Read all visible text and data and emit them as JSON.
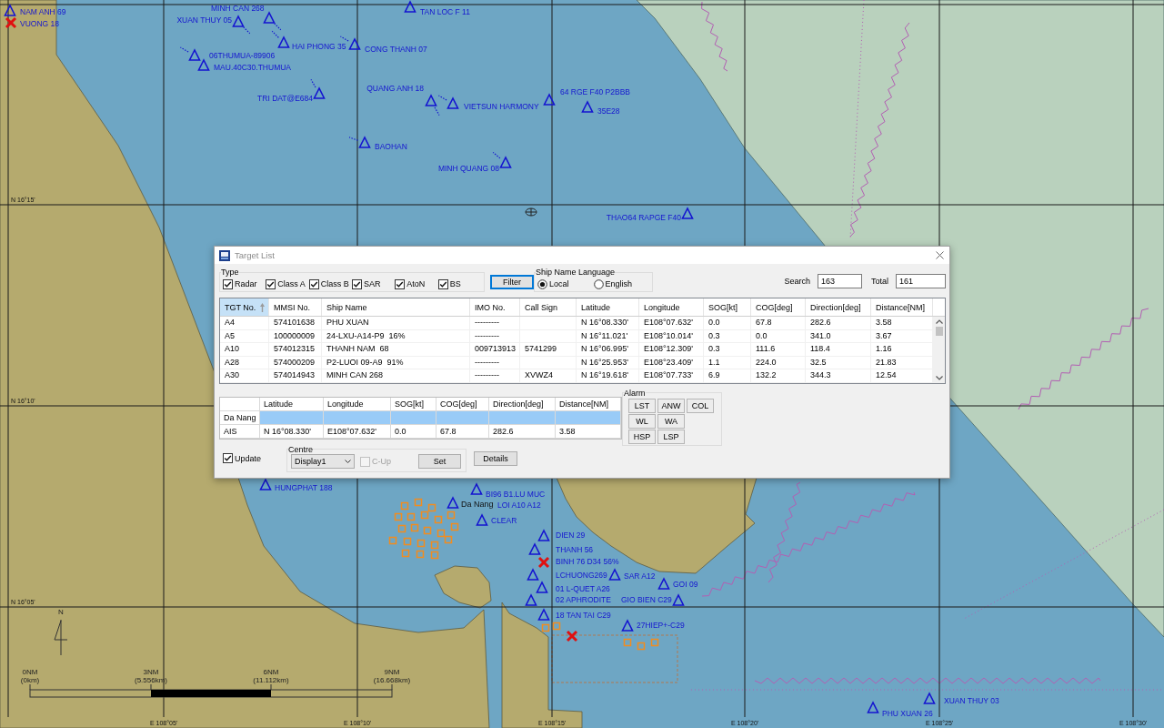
{
  "chart_map": {
    "latitude_labels": [
      "N 16°15'",
      "N 16°10'",
      "N 16°05'"
    ],
    "longitude_labels": [
      "E 108°05'",
      "E 108°10'",
      "E 108°15'",
      "E 108°20'",
      "E 108°25'",
      "E 108°30'"
    ],
    "targets": [
      {
        "kind": "ais",
        "name": "MINH CAN 268"
      },
      {
        "kind": "ais",
        "name": "NAM ANH 69"
      },
      {
        "kind": "ais",
        "name": "TAN LOC F 11"
      },
      {
        "kind": "ais",
        "name": "XUAN THUY 05"
      },
      {
        "kind": "lost",
        "name": "VUONG 18"
      },
      {
        "kind": "ais",
        "name": "HAI PHONG 35"
      },
      {
        "kind": "ais",
        "name": "CONG THANH 07"
      },
      {
        "kind": "ais",
        "name": "06THUMUA-89906"
      },
      {
        "kind": "ais",
        "name": "MAU.40C30.THUMUA"
      },
      {
        "kind": "ais",
        "name": "QUANG ANH 18"
      },
      {
        "kind": "ais",
        "name": "64 RGE F40 P2BBB"
      },
      {
        "kind": "ais",
        "name": "TRI DAT@E684"
      },
      {
        "kind": "ais",
        "name": "VIETSUN HARMONY"
      },
      {
        "kind": "ais",
        "name": "35E28"
      },
      {
        "kind": "ais",
        "name": "BAOHAN"
      },
      {
        "kind": "ais",
        "name": "MINH QUANG 08"
      },
      {
        "kind": "ais",
        "name": "THAO64 RAPGE F40"
      },
      {
        "kind": "ais",
        "name": "HUNGPHAT 188"
      },
      {
        "kind": "ais",
        "name": "BI96 B1.LU MUC"
      },
      {
        "kind": "ais",
        "name": "LOI A10 A12"
      },
      {
        "kind": "ais",
        "name": "CLEAR"
      },
      {
        "kind": "ais",
        "name": "DIEN 29"
      },
      {
        "kind": "ais",
        "name": "THANH 56"
      },
      {
        "kind": "lost",
        "name": "BINH 76 D34 56%"
      },
      {
        "kind": "ais",
        "name": "LCHUONG269"
      },
      {
        "kind": "ais",
        "name": "SAR A12"
      },
      {
        "kind": "ais",
        "name": "GOI 09"
      },
      {
        "kind": "ais",
        "name": "01 L-QUET A26"
      },
      {
        "kind": "ais",
        "name": "02 APHRODITE"
      },
      {
        "kind": "ais",
        "name": "GIO BIEN C29"
      },
      {
        "kind": "ais",
        "name": "18 TAN TAI C29"
      },
      {
        "kind": "ais",
        "name": "27HIEP+-C29"
      },
      {
        "kind": "ais",
        "name": "XUAN THUY 03"
      },
      {
        "kind": "ais",
        "name": "PHU XUAN 26"
      }
    ],
    "place_labels": [
      "Da Nang"
    ],
    "north_arrow": "N",
    "scale_bar": [
      {
        "distance": "0NM",
        "km": "(0km)"
      },
      {
        "distance": "3NM",
        "km": "(5.556km)"
      },
      {
        "distance": "6NM",
        "km": "(11.112km)"
      },
      {
        "distance": "9NM",
        "km": "(16.668km)"
      }
    ]
  },
  "target_list": {
    "title": "Target List",
    "type_filter": {
      "label": "Type",
      "options": [
        {
          "label": "Radar",
          "checked": true
        },
        {
          "label": "Class A",
          "checked": true
        },
        {
          "label": "Class B",
          "checked": true
        },
        {
          "label": "SAR",
          "checked": true
        },
        {
          "label": "AtoN",
          "checked": true
        },
        {
          "label": "BS",
          "checked": true
        }
      ]
    },
    "filter_button": {
      "label": "Filter",
      "focused": true
    },
    "ship_name_language": {
      "label": "Ship Name Language",
      "options": [
        {
          "label": "Local",
          "selected": true
        },
        {
          "label": "English",
          "selected": false
        }
      ]
    },
    "search": {
      "label": "Search",
      "value": "163"
    },
    "total": {
      "label": "Total",
      "value": "161"
    },
    "table": {
      "columns": [
        {
          "label": "TGT No.",
          "sorted": true
        },
        {
          "label": "MMSI No.",
          "sorted": false
        },
        {
          "label": "Ship Name",
          "sorted": false
        },
        {
          "label": "IMO No.",
          "sorted": false
        },
        {
          "label": "Call Sign",
          "sorted": false
        },
        {
          "label": "Latitude",
          "sorted": false
        },
        {
          "label": "Longitude",
          "sorted": false
        },
        {
          "label": "SOG[kt]",
          "sorted": false
        },
        {
          "label": "COG[deg]",
          "sorted": false
        },
        {
          "label": "Direction[deg]",
          "sorted": false
        },
        {
          "label": "Distance[NM]",
          "sorted": false
        }
      ],
      "rows": [
        {
          "cells": [
            "A4",
            "574101638",
            "PHU XUAN",
            "---------",
            null,
            "N 16°08.330'",
            "E108°07.632'",
            "0.0",
            "67.8",
            "282.6",
            "3.58"
          ]
        },
        {
          "cells": [
            "A5",
            "100000009",
            "24-LXU-A14-P9  16%",
            "---------",
            null,
            "N 16°11.021'",
            "E108°10.014'",
            "0.3",
            "0.0",
            "341.0",
            "3.67"
          ]
        },
        {
          "cells": [
            "A10",
            "574012315",
            "THANH NAM  68",
            "009713913",
            "5741299",
            "N 16°06.995'",
            "E108°12.309'",
            "0.3",
            "111.6",
            "118.4",
            "1.16"
          ]
        },
        {
          "cells": [
            "A28",
            "574000209",
            "P2-LUOI 09-A9  91%",
            "---------",
            null,
            "N 16°25.953'",
            "E108°23.409'",
            "1.1",
            "224.0",
            "32.5",
            "21.83"
          ]
        },
        {
          "cells": [
            "A30",
            "574014943",
            "MINH CAN 268",
            "---------",
            "XVWZ4",
            "N 16°19.618'",
            "E108°07.733'",
            "6.9",
            "132.2",
            "344.3",
            "12.54"
          ]
        }
      ]
    },
    "reference_table": {
      "columns": [
        "Latitude",
        "Longitude",
        "SOG[kt]",
        "COG[deg]",
        "Direction[deg]",
        "Distance[NM]"
      ],
      "rows": [
        {
          "label": "Da Nang",
          "selected": true
        },
        {
          "label": "AIS",
          "selected": false,
          "cells": [
            "N 16°08.330'",
            "E108°07.632'",
            "0.0",
            "67.8",
            "282.6",
            "3.58"
          ]
        }
      ]
    },
    "update": {
      "label": "Update",
      "checked": true
    },
    "centre": {
      "label": "Centre",
      "display": "Display1",
      "c_up": {
        "label": "C-Up",
        "checked": false,
        "disabled": true
      },
      "set_button": "Set"
    },
    "details_button": "Details",
    "alarm": {
      "label": "Alarm",
      "buttons": [
        "LST",
        "ANW",
        "COL",
        "WL",
        "WA",
        "HSP",
        "LSP"
      ]
    }
  }
}
